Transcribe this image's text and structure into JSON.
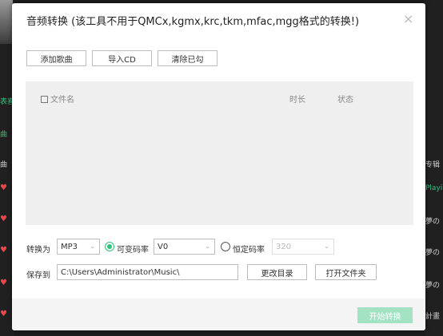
{
  "background": {
    "left_labels": [
      "表喜",
      "曲",
      "曲"
    ],
    "right_labels": [
      "专辑",
      "Playi",
      "夢の",
      "夢の",
      "夢の",
      "計畫"
    ]
  },
  "dialog": {
    "title": "音频转换 (该工具不用于QMCx,kgmx,krc,tkm,mfac,mgg格式的转换!)",
    "close_glyph": "×",
    "toolbar": {
      "add_song": "添加歌曲",
      "import_cd": "导入CD",
      "clear_checked": "清除已勾"
    },
    "list": {
      "col_filename": "文件名",
      "col_duration": "时长",
      "col_status": "状态"
    },
    "convert": {
      "label": "转换为",
      "format_value": "MP3",
      "vbr_label": "可变码率",
      "vbr_value": "V0",
      "cbr_label": "恒定码率",
      "cbr_value": "320",
      "vbr_selected": true
    },
    "save": {
      "label": "保存到",
      "path_value": "C:\\Users\\Administrator\\Music\\",
      "change_dir": "更改目录",
      "open_folder": "打开文件夹"
    },
    "start_button": "开始转换"
  },
  "colors": {
    "accent": "#31c27c",
    "accent_disabled": "#a4e2c4",
    "heart": "#e5484d"
  }
}
